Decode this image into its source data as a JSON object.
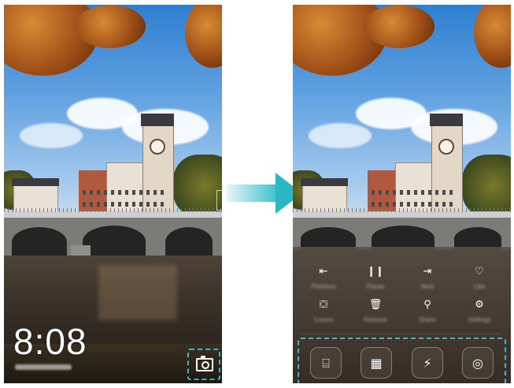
{
  "left_screen": {
    "time": "8:08",
    "icons": {
      "camera": "camera-icon"
    }
  },
  "right_screen": {
    "controls": [
      {
        "name": "previous",
        "label": "Previous",
        "glyph": "⇤"
      },
      {
        "name": "pause",
        "label": "Pause",
        "glyph": "❙❙"
      },
      {
        "name": "next",
        "label": "Next",
        "glyph": "⇥"
      },
      {
        "name": "like",
        "label": "Like",
        "glyph": "♡"
      },
      {
        "name": "covers",
        "label": "Covers",
        "glyph": "⛋"
      },
      {
        "name": "remove",
        "label": "Remove",
        "glyph": "🗑"
      },
      {
        "name": "share",
        "label": "Share",
        "glyph": "⚲"
      },
      {
        "name": "settings",
        "label": "Settings",
        "glyph": "⚙"
      }
    ],
    "shortcuts": [
      {
        "name": "recorder",
        "glyph": "⌸"
      },
      {
        "name": "calculator",
        "glyph": "▦"
      },
      {
        "name": "flashlight",
        "glyph": "⚡"
      },
      {
        "name": "camera",
        "glyph": "◎"
      }
    ]
  },
  "colors": {
    "accent": "#2ab7c4",
    "dashed_highlight": "#3fb6c8"
  }
}
